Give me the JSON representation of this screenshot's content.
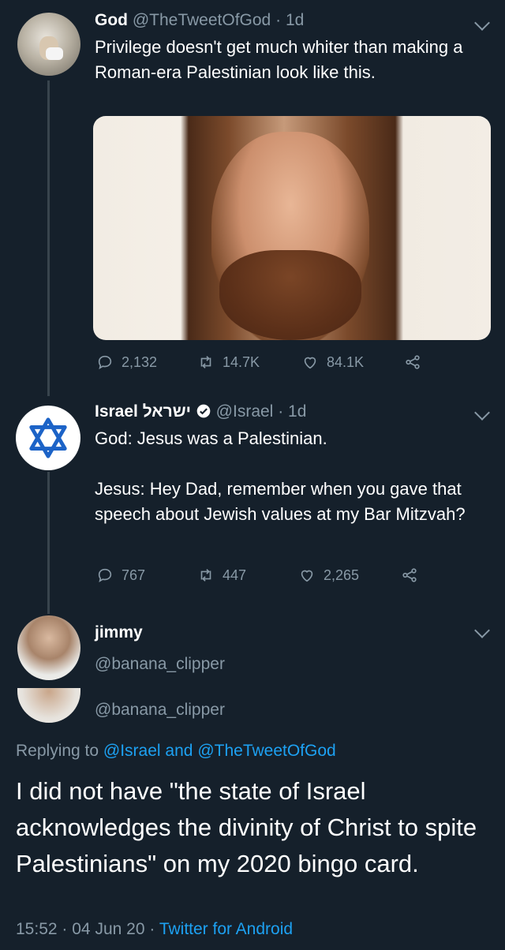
{
  "tweet1": {
    "name": "God",
    "handle": "@TheTweetOfGod",
    "time": "1d",
    "text": "Privilege doesn't get much whiter than making a Roman-era Palestinian look like this.",
    "replies": "2,132",
    "retweets": "14.7K",
    "likes": "84.1K"
  },
  "tweet2": {
    "name": "Israel ישראל",
    "handle": "@Israel",
    "time": "1d",
    "text_line1": "God: Jesus was a Palestinian.",
    "text_line2": "Jesus: Hey Dad, remember when you gave that speech about Jewish values at my Bar Mitzvah?",
    "replies": "767",
    "retweets": "447",
    "likes": "2,265"
  },
  "tweet3": {
    "name": "jimmy",
    "handle": "@banana_clipper",
    "handle_repeat": "@banana_clipper",
    "replying_prefix": "Replying to",
    "replying_to_1": "@Israel",
    "replying_and": "and",
    "replying_to_2": "@TheTweetOfGod",
    "text": "I did not have \"the state of Israel acknowledges the divinity of Christ to spite Palestinians\" on my 2020 bingo card.",
    "time": "15:52",
    "date": "04 Jun 20",
    "source": "Twitter for Android"
  },
  "colors": {
    "background": "#15202b",
    "muted": "#8899a6",
    "link": "#1da1f2",
    "verified": "#1da1f2"
  },
  "icons": [
    "reply-icon",
    "retweet-icon",
    "like-icon",
    "share-icon",
    "chevron-down-icon",
    "verified-badge-icon",
    "star-of-david-icon"
  ]
}
